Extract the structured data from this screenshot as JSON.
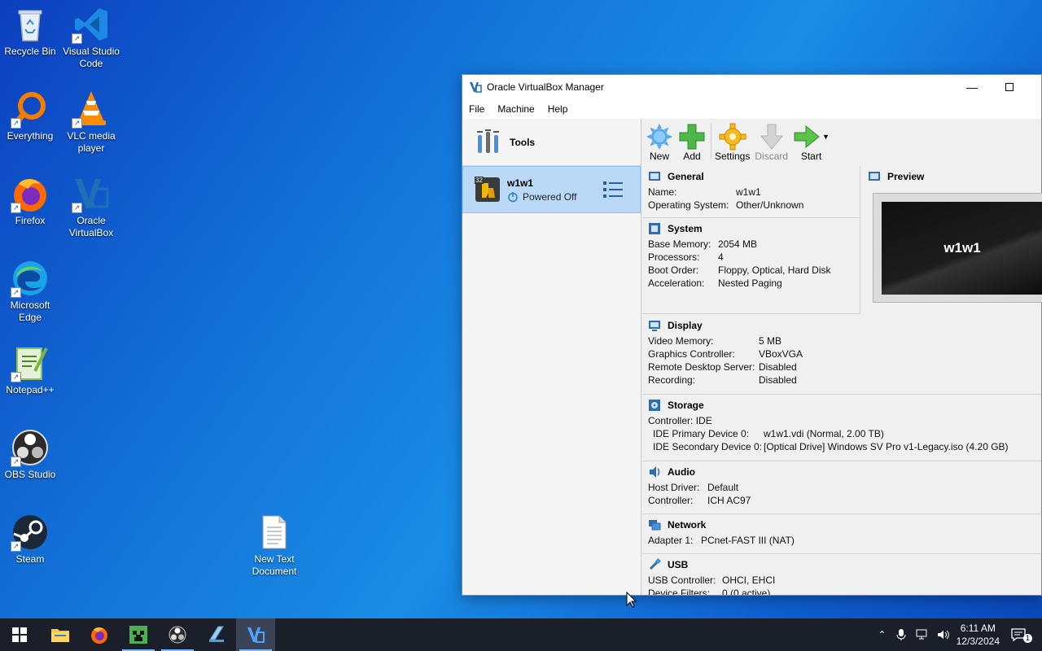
{
  "desktop": {
    "icons": [
      {
        "label": "Recycle Bin",
        "icon": "recycle-bin-icon"
      },
      {
        "label": "Visual Studio Code",
        "icon": "vscode-icon"
      },
      {
        "label": "Everything",
        "icon": "everything-search-icon"
      },
      {
        "label": "VLC media player",
        "icon": "vlc-icon"
      },
      {
        "label": "Firefox",
        "icon": "firefox-icon"
      },
      {
        "label": "Oracle VirtualBox",
        "icon": "virtualbox-icon"
      },
      {
        "label": "Microsoft Edge",
        "icon": "edge-icon"
      },
      {
        "label": "Notepad++",
        "icon": "notepadpp-icon"
      },
      {
        "label": "OBS Studio",
        "icon": "obs-icon"
      },
      {
        "label": "Steam",
        "icon": "steam-icon"
      },
      {
        "label": "New Text Document",
        "icon": "text-file-icon"
      }
    ]
  },
  "window": {
    "title": "Oracle VirtualBox Manager",
    "menu": [
      "File",
      "Machine",
      "Help"
    ],
    "tools_label": "Tools",
    "vm": {
      "name": "w1w1",
      "state": "Powered Off",
      "badge": "32"
    },
    "toolbar": {
      "new": "New",
      "add": "Add",
      "settings": "Settings",
      "discard": "Discard",
      "start": "Start"
    },
    "preview": {
      "title": "Preview",
      "screen_text": "w1w1"
    },
    "sections": {
      "general": {
        "title": "General",
        "rows": [
          [
            "Name:",
            "w1w1"
          ],
          [
            "Operating System:",
            "Other/Unknown"
          ]
        ]
      },
      "system": {
        "title": "System",
        "rows": [
          [
            "Base Memory:",
            "2054 MB"
          ],
          [
            "Processors:",
            "4"
          ],
          [
            "Boot Order:",
            "Floppy, Optical, Hard Disk"
          ],
          [
            "Acceleration:",
            "Nested Paging"
          ]
        ]
      },
      "display": {
        "title": "Display",
        "rows": [
          [
            "Video Memory:",
            "5 MB"
          ],
          [
            "Graphics Controller:",
            "VBoxVGA"
          ],
          [
            "Remote Desktop Server:",
            "Disabled"
          ],
          [
            "Recording:",
            "Disabled"
          ]
        ]
      },
      "storage": {
        "title": "Storage",
        "controller": "Controller: IDE",
        "rows": [
          [
            "IDE Primary Device 0:",
            "w1w1.vdi (Normal, 2.00 TB)"
          ],
          [
            "IDE Secondary Device 0:",
            "[Optical Drive] Windows SV Pro v1-Legacy.iso (4.20 GB)"
          ]
        ]
      },
      "audio": {
        "title": "Audio",
        "rows": [
          [
            "Host Driver:",
            "Default"
          ],
          [
            "Controller:",
            "ICH AC97"
          ]
        ]
      },
      "network": {
        "title": "Network",
        "rows": [
          [
            "Adapter 1:",
            "PCnet-FAST III (NAT)"
          ]
        ]
      },
      "usb": {
        "title": "USB",
        "rows": [
          [
            "USB Controller:",
            "OHCI, EHCI"
          ],
          [
            "Device Filters:",
            "0 (0 active)"
          ]
        ]
      }
    }
  },
  "taskbar": {
    "time": "6:11 AM",
    "date": "12/3/2024",
    "notifications": "1"
  }
}
